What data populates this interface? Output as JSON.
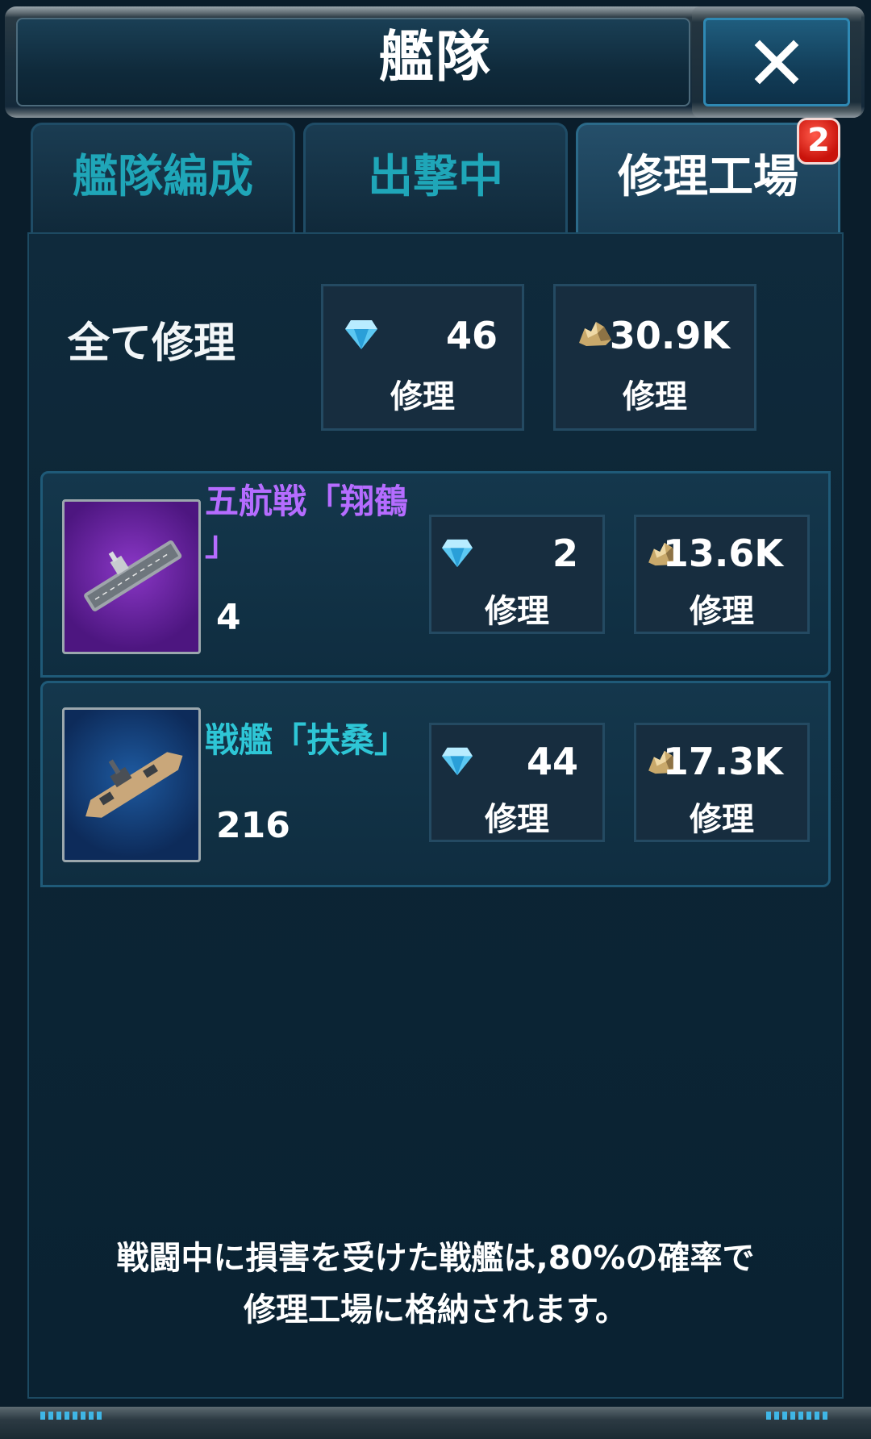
{
  "header": {
    "title": "艦隊"
  },
  "tabs": [
    {
      "label": "艦隊編成",
      "active": false
    },
    {
      "label": "出撃中",
      "active": false
    },
    {
      "label": "修理工場",
      "active": true,
      "badge": "2"
    }
  ],
  "repair_all": {
    "label": "全て修理",
    "gem_cost": "46",
    "ore_cost": "30.9K",
    "button_label": "修理"
  },
  "ships": [
    {
      "name_line1": "五航戦「翔鶴",
      "name_line2": "」",
      "count": "4",
      "name_color": "#b56cff",
      "gem_cost": "2",
      "ore_cost": "13.6K",
      "button_label": "修理"
    },
    {
      "name_line1": "戦艦「扶桑」",
      "count": "216",
      "name_color": "#2ec6d6",
      "gem_cost": "44",
      "ore_cost": "17.3K",
      "button_label": "修理"
    }
  ],
  "footer": {
    "line1": "戦闘中に損害を受けた戦艦は,80%の確率で",
    "line2": "修理工場に格納されます。"
  },
  "icons": {
    "gem": "diamond-icon",
    "ore": "ore-icon",
    "close": "close-icon"
  },
  "colors": {
    "accent": "#1fa6b8",
    "badge": "#d81a10"
  }
}
